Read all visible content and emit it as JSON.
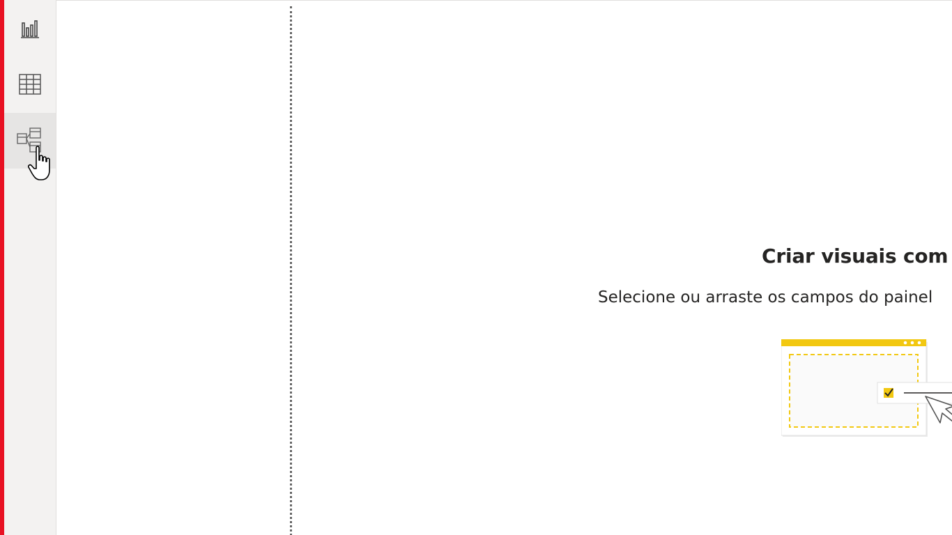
{
  "theme": {
    "accent_red": "#e81123",
    "rail_background": "#f3f2f1",
    "rail_active_background": "#e6e5e4",
    "callout_arrow_color": "#0000ff",
    "illustration_yellow": "#f2c811"
  },
  "left_rail": {
    "items": [
      {
        "icon": "bar-chart-icon",
        "label": ""
      },
      {
        "icon": "table-grid-icon",
        "label": ""
      },
      {
        "icon": "model-view-icon",
        "label": "",
        "active": true
      }
    ]
  },
  "canvas": {
    "empty_state": {
      "title": "Criar visuais com s",
      "subtitle": "Selecione ou arraste os campos do painel"
    }
  },
  "annotations": {
    "callout_arrow": "blue-left-arrow",
    "cursor": "hand-pointer"
  }
}
